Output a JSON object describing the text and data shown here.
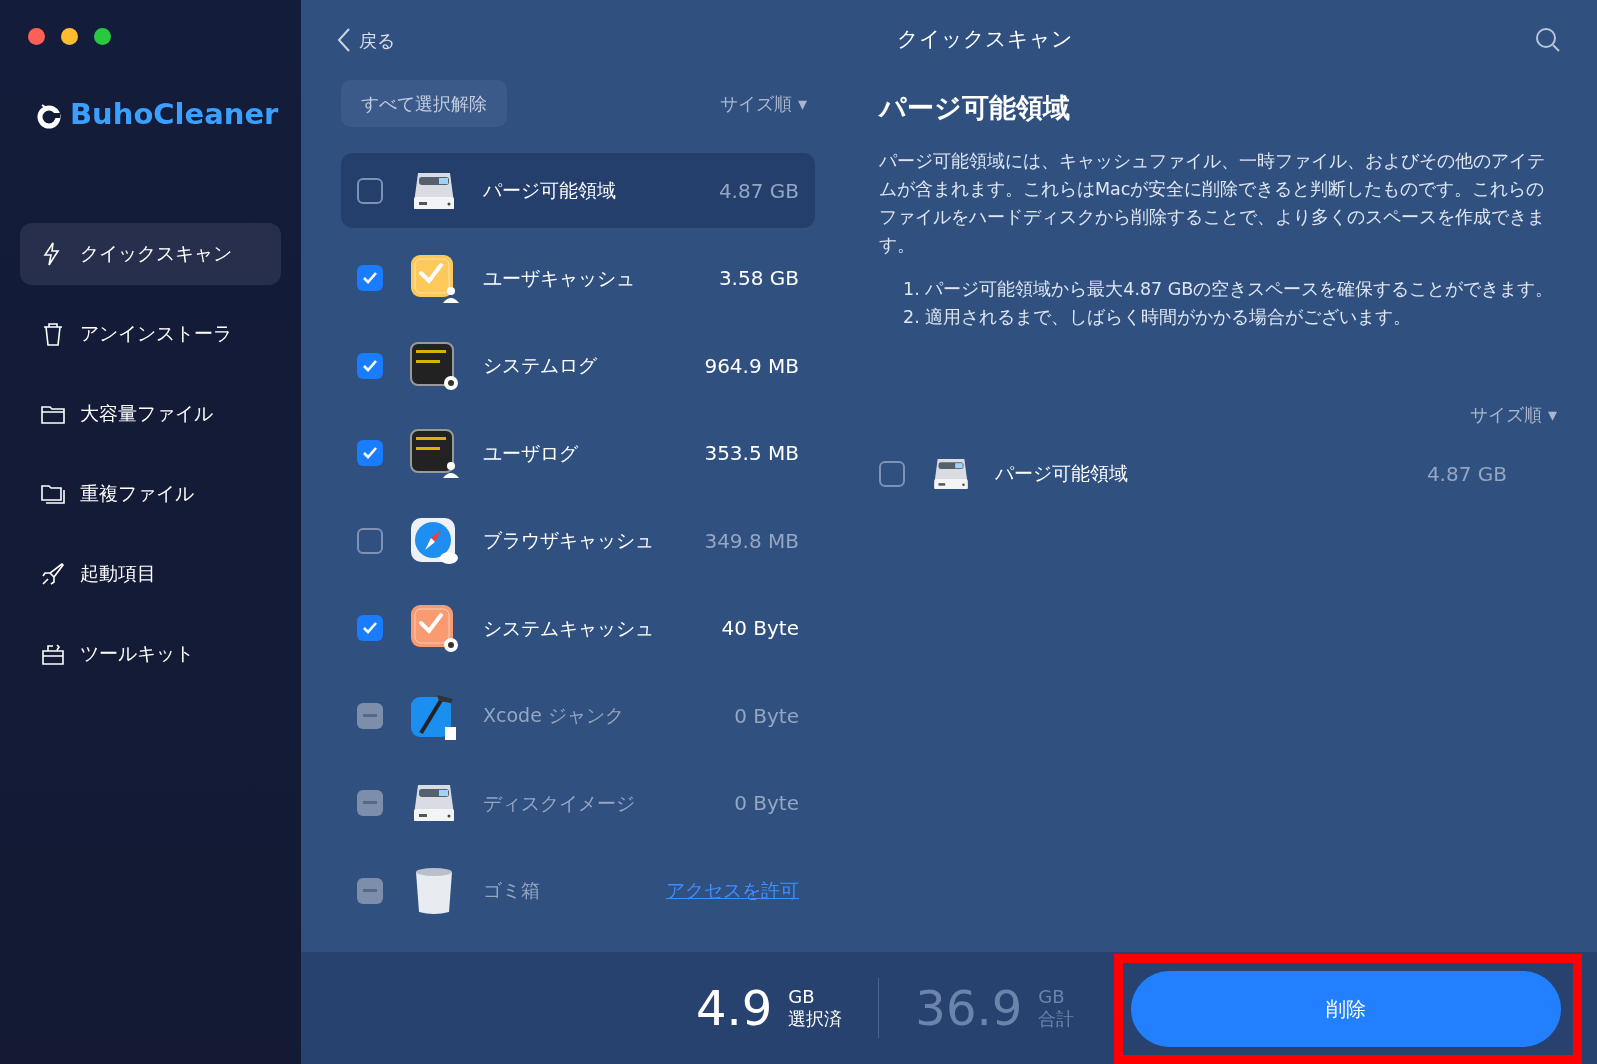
{
  "app": {
    "name": "BuhoCleaner"
  },
  "sidebar": {
    "items": [
      {
        "label": "クイックスキャン",
        "selected": true
      },
      {
        "label": "アンインストーラ",
        "selected": false
      },
      {
        "label": "大容量ファイル",
        "selected": false
      },
      {
        "label": "重複ファイル",
        "selected": false
      },
      {
        "label": "起動項目",
        "selected": false
      },
      {
        "label": "ツールキット",
        "selected": false
      }
    ]
  },
  "header": {
    "back": "戻る",
    "title": "クイックスキャン"
  },
  "list": {
    "deselect_all": "すべて選択解除",
    "sort": "サイズ順 ▾",
    "items": [
      {
        "name": "パージ可能領域",
        "size": "4.87 GB",
        "checked": false,
        "disabled": false,
        "selected": true
      },
      {
        "name": "ユーザキャッシュ",
        "size": "3.58 GB",
        "checked": true,
        "disabled": false,
        "selected": false
      },
      {
        "name": "システムログ",
        "size": "964.9 MB",
        "checked": true,
        "disabled": false,
        "selected": false
      },
      {
        "name": "ユーザログ",
        "size": "353.5 MB",
        "checked": true,
        "disabled": false,
        "selected": false
      },
      {
        "name": "ブラウザキャッシュ",
        "size": "349.8 MB",
        "checked": false,
        "disabled": false,
        "selected": false
      },
      {
        "name": "システムキャッシュ",
        "size": "40 Byte",
        "checked": true,
        "disabled": false,
        "selected": false
      },
      {
        "name": "Xcode ジャンク",
        "size": "0 Byte",
        "disabled": true,
        "selected": false
      },
      {
        "name": "ディスクイメージ",
        "size": "0 Byte",
        "disabled": true,
        "selected": false
      },
      {
        "name": "ゴミ箱",
        "link": "アクセスを許可",
        "disabled": true,
        "selected": false
      }
    ]
  },
  "detail": {
    "title": "パージ可能領域",
    "description": "パージ可能領域には、キャッシュファイル、一時ファイル、およびその他のアイテムが含まれます。これらはMacが安全に削除できると判断したものです。これらのファイルをハードディスクから削除することで、より多くのスペースを作成できます。",
    "notes": [
      "1. パージ可能領域から最大4.87 GBの空きスペースを確保することができます。",
      "2. 適用されるまで、しばらく時間がかかる場合がございます。"
    ],
    "sort": "サイズ順 ▾",
    "items": [
      {
        "name": "パージ可能領域",
        "size": "4.87 GB",
        "checked": false
      }
    ]
  },
  "footer": {
    "selected_value": "4.9",
    "selected_unit": "GB",
    "selected_label": "選択済",
    "total_value": "36.9",
    "total_unit": "GB",
    "total_label": "合計",
    "delete_button": {
      "label": "削除",
      "highlighted": true
    }
  }
}
